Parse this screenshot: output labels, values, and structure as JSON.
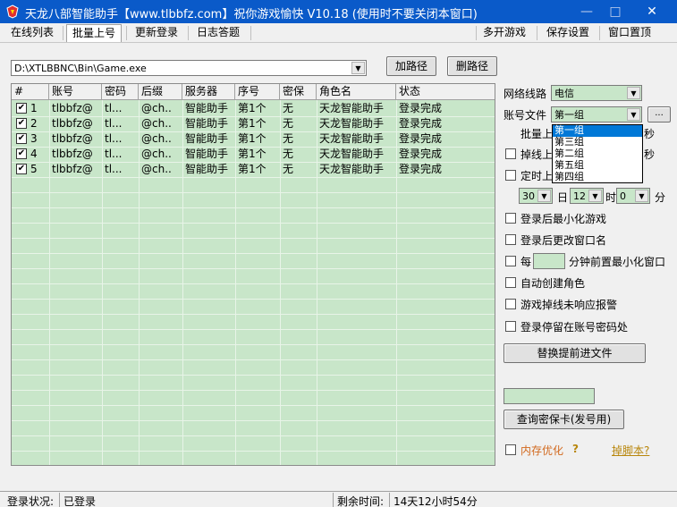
{
  "window": {
    "title": "天龙八部智能助手【www.tlbbfz.com】祝你游戏愉快 V10.18 (使用时不要关闭本窗口)",
    "minimize_icon": "minimize-icon",
    "maximize_icon": "maximize-icon",
    "close_icon": "close-icon"
  },
  "menu": {
    "left": [
      "在线列表",
      "批量上号",
      "更新登录",
      "日志答题"
    ],
    "active": "批量上号",
    "right": [
      "多开游戏",
      "保存设置",
      "窗口置顶"
    ]
  },
  "path": {
    "value": "D:\\XTLBBNC\\Bin\\Game.exe",
    "add_button": "加路径",
    "delete_button": "删路径"
  },
  "table": {
    "columns": [
      "#",
      "账号",
      "密码",
      "后缀",
      "服务器",
      "序号",
      "密保",
      "角色名",
      "状态"
    ],
    "rows": [
      {
        "checked": true,
        "num": "1",
        "account": "tlbbfz@",
        "password": "tl...",
        "suffix": "@ch..",
        "server": "智能助手",
        "index": "第1个",
        "security": "无",
        "role": "天龙智能助手",
        "status": "登录完成"
      },
      {
        "checked": true,
        "num": "2",
        "account": "tlbbfz@",
        "password": "tl...",
        "suffix": "@ch..",
        "server": "智能助手",
        "index": "第1个",
        "security": "无",
        "role": "天龙智能助手",
        "status": "登录完成"
      },
      {
        "checked": true,
        "num": "3",
        "account": "tlbbfz@",
        "password": "tl...",
        "suffix": "@ch..",
        "server": "智能助手",
        "index": "第1个",
        "security": "无",
        "role": "天龙智能助手",
        "status": "登录完成"
      },
      {
        "checked": true,
        "num": "4",
        "account": "tlbbfz@",
        "password": "tl...",
        "suffix": "@ch..",
        "server": "智能助手",
        "index": "第1个",
        "security": "无",
        "role": "天龙智能助手",
        "status": "登录完成"
      },
      {
        "checked": true,
        "num": "5",
        "account": "tlbbfz@",
        "password": "tl...",
        "suffix": "@ch..",
        "server": "智能助手",
        "index": "第1个",
        "security": "无",
        "role": "天龙智能助手",
        "status": "登录完成"
      }
    ]
  },
  "settings": {
    "network_label": "网络线路",
    "network_value": "电信",
    "account_file_label": "账号文件",
    "account_file_value": "第一组",
    "browse_button": "...",
    "account_file_options": [
      "第一组",
      "第三组",
      "第二组",
      "第五组",
      "第四组"
    ],
    "batch_prefix": "批量上",
    "batch_suffix": "秒",
    "drop_prefix": "掉线上",
    "drop_suffix": "秒",
    "timed_prefix": "定时上",
    "day_value": "30",
    "day_label": "日",
    "hour_value": "12",
    "hour_label": "时",
    "minute_value": "0",
    "minute_label": "分",
    "min_after_login": "登录后最小化游戏",
    "rename_after_login": "登录后更改窗口名",
    "every_label": "每",
    "every_suffix": "分钟前置最小化窗口",
    "auto_create_role": "自动创建角色",
    "drop_alarm": "游戏掉线未响应报警",
    "stay_at_account": "登录停留在账号密码处",
    "replace_button": "替换提前进文件",
    "query_card_button": "查询密保卡(发号用)",
    "memory_opt": "内存优化",
    "help_mark": "?",
    "script_link": "掉脚本?"
  },
  "status": {
    "login_label": "登录状况:",
    "login_value": "已登录",
    "remaining_label": "剩余时间:",
    "remaining_value": "14天12小时54分"
  },
  "colors": {
    "titlebar": "#0a5ac9",
    "grid_bg": "#c8e6c9",
    "selection": "#0078d7",
    "warning_text": "#b8860b",
    "memory_text": "#d2691e"
  }
}
